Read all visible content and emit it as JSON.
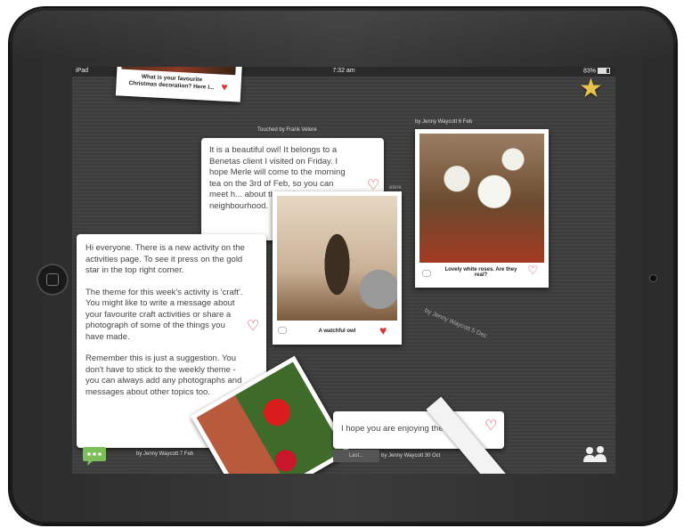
{
  "status": {
    "carrier": "iPad",
    "time": "7:32 am",
    "battery": "83%"
  },
  "top_card": {
    "text": "What is your favourite Christmas decoration? Here I..."
  },
  "owl_text_card": {
    "header": "Touched by Frank Vetere",
    "text": "It is a beautiful owl! It belongs to a Benetas client I visited on Friday. I hope Merle will come to the morning tea on the 3rd of Feb, so you can meet h... about the owls ... neighbourhood.",
    "partial_right": "etere"
  },
  "owl_photo": {
    "caption": "A watchful owl"
  },
  "roses_photo": {
    "header": "by Jenny Waycott 6 Feb",
    "caption": "Lovely white roses. Are they real?"
  },
  "rotated_byline": "by Jenny Waycott 5 Dec",
  "activity_card": {
    "p1": "Hi everyone. There is a new activity on the activities page. To see it press on the gold star in the top right corner.",
    "p2": "The theme for this week's activity is 'craft'. You might like to write a message about your favourite craft activities or share a photograph of some of the things you have made.",
    "p3": "Remember this is just a suggestion. You don't have to stick to the weekly theme - you can always add any photographs and messages about other topics too.",
    "byline": "by Jenny Waycott 7 Feb"
  },
  "bottom_card": {
    "text": "I hope you are enjoying the s...",
    "byline": "by Jenny Waycott 30 Oct"
  },
  "last_button": {
    "label": "Last..."
  },
  "icons": {
    "star": "star-icon",
    "heart": "heart-icon",
    "people": "people-icon",
    "chat": "chat-icon"
  },
  "colors": {
    "heart": "#dd3333",
    "star": "#e8c24a",
    "chat_green": "#7cbf5a"
  }
}
